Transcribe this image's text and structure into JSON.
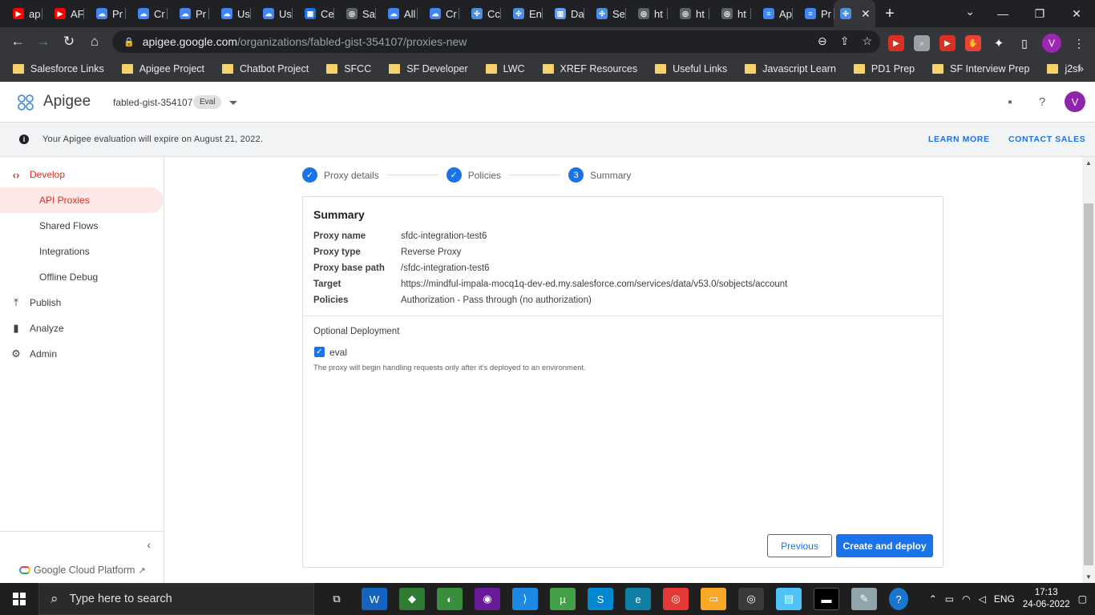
{
  "browser": {
    "tabs": [
      {
        "label": "ap",
        "icon": "youtube-icon",
        "color": "#ff0000"
      },
      {
        "label": "AF",
        "icon": "youtube-icon",
        "color": "#ff0000"
      },
      {
        "label": "Pr",
        "icon": "google-cloud-icon",
        "color": "#4285f4"
      },
      {
        "label": "Cr",
        "icon": "google-cloud-icon",
        "color": "#4285f4"
      },
      {
        "label": "Pr",
        "icon": "google-cloud-icon",
        "color": "#4285f4"
      },
      {
        "label": "Us",
        "icon": "google-cloud-icon",
        "color": "#4285f4"
      },
      {
        "label": "Us",
        "icon": "google-cloud-icon",
        "color": "#4285f4"
      },
      {
        "label": "Ce",
        "icon": "grid-icon",
        "color": "#1a73e8"
      },
      {
        "label": "Sa",
        "icon": "globe-icon",
        "color": "#9aa0a6"
      },
      {
        "label": "All",
        "icon": "google-cloud-icon",
        "color": "#4285f4"
      },
      {
        "label": "Cr",
        "icon": "google-cloud-icon",
        "color": "#4285f4"
      },
      {
        "label": "Cc",
        "icon": "apigee-icon",
        "color": "#4a90e2"
      },
      {
        "label": "En",
        "icon": "apigee-icon",
        "color": "#4a90e2"
      },
      {
        "label": "Da",
        "icon": "dashboard-icon",
        "color": "#5c9ded"
      },
      {
        "label": "Se",
        "icon": "apigee-icon",
        "color": "#4a90e2"
      },
      {
        "label": "ht",
        "icon": "globe-icon",
        "color": "#9aa0a6"
      },
      {
        "label": "ht",
        "icon": "globe-icon",
        "color": "#9aa0a6"
      },
      {
        "label": "ht",
        "icon": "globe-icon",
        "color": "#9aa0a6"
      },
      {
        "label": "Ap",
        "icon": "docs-icon",
        "color": "#4285f4"
      },
      {
        "label": "Pr",
        "icon": "docs-icon",
        "color": "#4285f4"
      }
    ],
    "active_tab_icon": "apigee-icon",
    "url_host": "apigee.google.com",
    "url_path": "/organizations/fabled-gist-354107/proxies-new",
    "profile_initial": "V",
    "bookmarks": [
      "Salesforce Links",
      "Apigee Project",
      "Chatbot Project",
      "SFCC",
      "SF Developer",
      "LWC",
      "XREF Resources",
      "Useful Links",
      "Javascript Learn",
      "PD1 Prep",
      "SF Interview Prep",
      "j2sf"
    ]
  },
  "app": {
    "name": "Apigee",
    "project": "fabled-gist-354107",
    "project_badge": "Eval",
    "avatar_initial": "V",
    "brand_color": "#1a73e8",
    "accent_red": "#d93025"
  },
  "banner": {
    "info_glyph": "i",
    "text": "Your Apigee evaluation will expire on August 21, 2022.",
    "learn_more": "LEARN MORE",
    "contact_sales": "CONTACT SALES"
  },
  "sidebar": {
    "develop": "Develop",
    "sub_items": [
      "API Proxies",
      "Shared Flows",
      "Integrations",
      "Offline Debug"
    ],
    "publish": "Publish",
    "analyze": "Analyze",
    "admin": "Admin",
    "gcp_link": "Google Cloud Platform"
  },
  "stepper": {
    "step1": "Proxy details",
    "step2": "Policies",
    "step3": "Summary",
    "step3_number": "3"
  },
  "summary": {
    "title": "Summary",
    "rows": [
      {
        "key": "Proxy name",
        "value": "sfdc-integration-test6"
      },
      {
        "key": "Proxy type",
        "value": "Reverse Proxy"
      },
      {
        "key": "Proxy base path",
        "value": "/sfdc-integration-test6"
      },
      {
        "key": "Target",
        "value": "https://mindful-impala-mocq1q-dev-ed.my.salesforce.com/services/data/v53.0/sobjects/account"
      },
      {
        "key": "Policies",
        "value": "Authorization - Pass through (no authorization)"
      }
    ],
    "optional_deployment": "Optional Deployment",
    "env_label": "eval",
    "env_checked": true,
    "hint": "The proxy will begin handling requests only after it's deployed to an environment.",
    "previous": "Previous",
    "create_deploy": "Create and deploy"
  },
  "taskbar": {
    "search_placeholder": "Type here to search",
    "language": "ENG",
    "time": "17:13",
    "date": "24-06-2022"
  }
}
